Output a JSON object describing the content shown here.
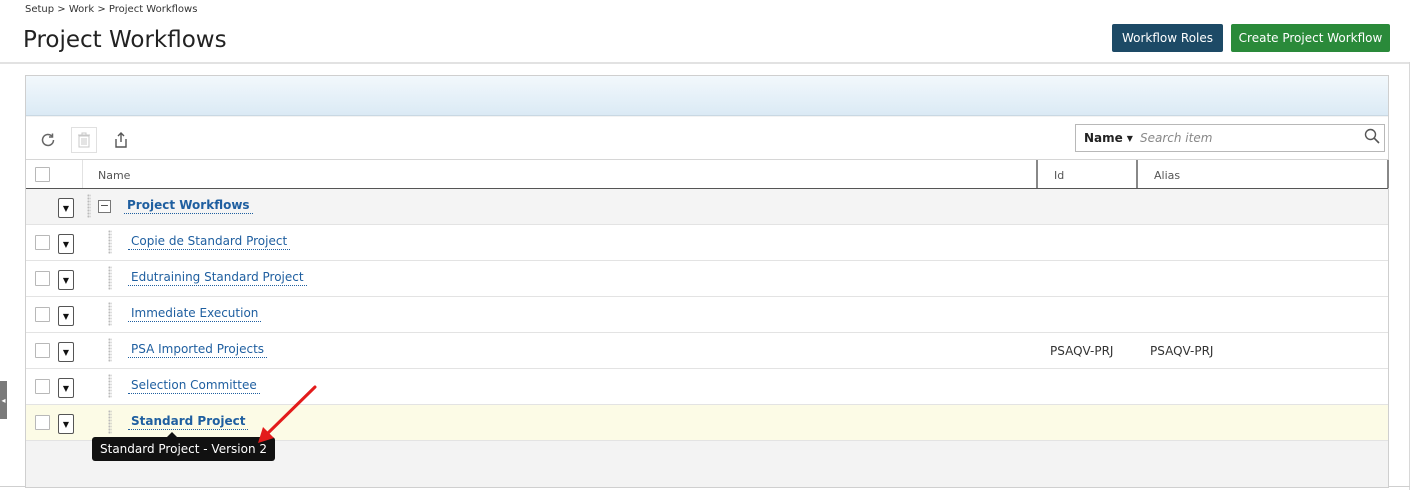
{
  "breadcrumb": "Setup > Work > Project Workflows",
  "page_title": "Project Workflows",
  "header_buttons": {
    "workflow_roles": "Workflow Roles",
    "create_project_workflow": "Create Project Workflow"
  },
  "toolbar": {
    "refresh_icon": "refresh-icon",
    "delete_icon": "trash-icon",
    "export_icon": "export-icon"
  },
  "search": {
    "field": "Name",
    "placeholder": "Search item"
  },
  "columns": {
    "name": "Name",
    "id": "Id",
    "alias": "Alias"
  },
  "group_row": {
    "label": "Project Workflows"
  },
  "rows": [
    {
      "name": "Copie de Standard Project",
      "id": "",
      "alias": ""
    },
    {
      "name": "Edutraining Standard Project",
      "id": "",
      "alias": ""
    },
    {
      "name": "Immediate Execution",
      "id": "",
      "alias": ""
    },
    {
      "name": "PSA Imported Projects",
      "id": "PSAQV-PRJ",
      "alias": "PSAQV-PRJ"
    },
    {
      "name": "Selection Committee",
      "id": "",
      "alias": ""
    },
    {
      "name": "Standard Project",
      "id": "",
      "alias": ""
    }
  ],
  "tooltip": "Standard Project - Version 2",
  "colors": {
    "workflow_roles_button": "#1d4a66",
    "create_button": "#2a8a3a",
    "link": "#1f5fa0",
    "highlight_row": "#fcfbe6",
    "annotation_arrow": "#e31b1b"
  }
}
